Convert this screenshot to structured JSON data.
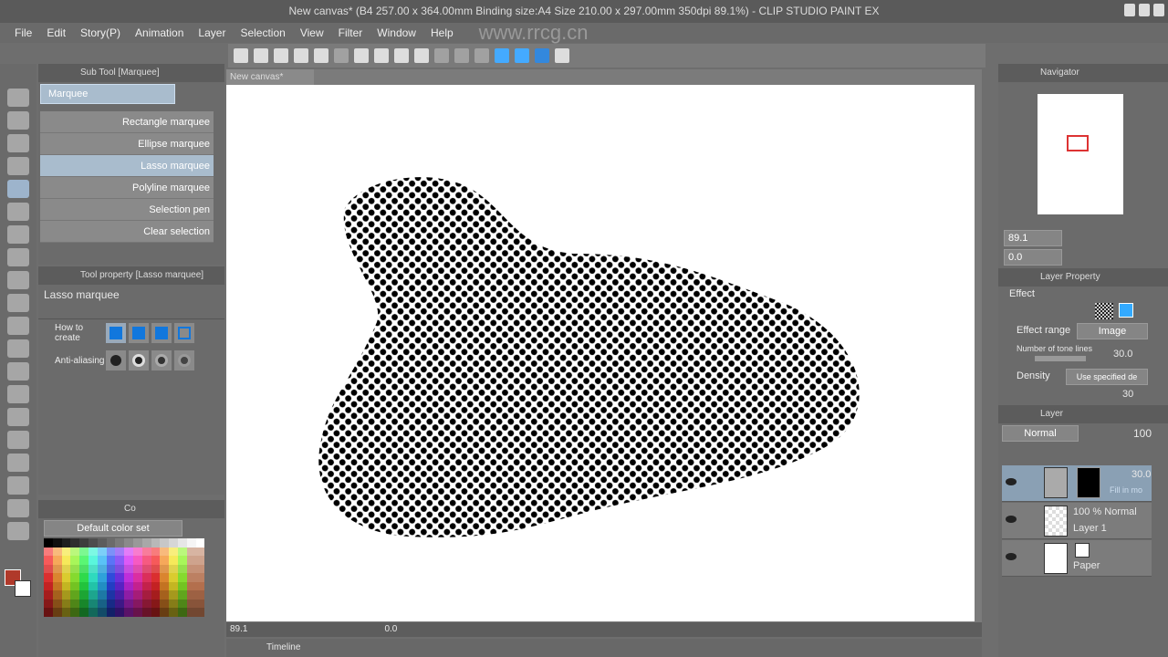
{
  "title": "New canvas* (B4 257.00 x 364.00mm Binding size:A4 Size 210.00 x 297.00mm 350dpi 89.1%)  - CLIP STUDIO PAINT EX",
  "menu": [
    "File",
    "Edit",
    "Story(P)",
    "Animation",
    "Layer",
    "Selection",
    "View",
    "Filter",
    "Window",
    "Help"
  ],
  "subtool": {
    "header": "Sub Tool [Marquee]",
    "group": "Marquee",
    "items": [
      {
        "label": "Rectangle marquee",
        "selected": false
      },
      {
        "label": "Ellipse marquee",
        "selected": false
      },
      {
        "label": "Lasso marquee",
        "selected": true
      },
      {
        "label": "Polyline marquee",
        "selected": false
      },
      {
        "label": "Selection pen",
        "selected": false
      },
      {
        "label": "Clear selection",
        "selected": false
      }
    ]
  },
  "toolprop": {
    "header": "Tool property [Lasso marquee]",
    "name": "Lasso marquee",
    "how_to_create": "How to create",
    "anti_aliasing": "Anti-aliasing"
  },
  "color": {
    "tab": "Co",
    "set": "Default color set",
    "main": "#b0392a",
    "sub": "#ffffff"
  },
  "doc_tab": "New canvas*",
  "status": {
    "zoom": "89.1",
    "angle": "0.0"
  },
  "timeline": "Timeline",
  "navigator": {
    "header": "Navigator",
    "zoom": "89.1",
    "angle": "0.0"
  },
  "layer_property": {
    "header": "Layer Property",
    "effect": "Effect",
    "effect_range_label": "Effect range",
    "effect_range": "Image",
    "tone_lines_label": "Number of tone lines",
    "tone_lines": "30.0",
    "density_label": "Density",
    "density": "Use specified de",
    "density_value": "30"
  },
  "layer_panel": {
    "header": "Layer",
    "blend": "Normal",
    "opacity": "100",
    "layers": [
      {
        "line1": "30.0",
        "line2": "Fill in mo"
      },
      {
        "line1": "100 %  Normal",
        "line2": "Layer 1"
      },
      {
        "line1": "",
        "line2": "Paper"
      }
    ]
  },
  "watermark": "www.rrcg.cn"
}
